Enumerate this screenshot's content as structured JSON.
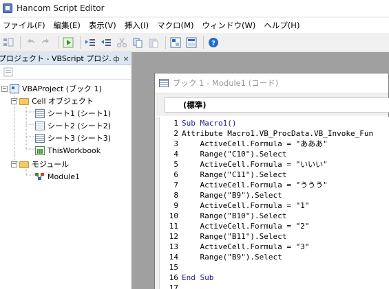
{
  "window": {
    "title": "Hancom Script Editor"
  },
  "menu": [
    "ファイル(F)",
    "編集(E)",
    "表示(V)",
    "挿入(I)",
    "マクロ(M)",
    "ウィンドウ(W)",
    "ヘルプ(H)"
  ],
  "toolbar": {
    "buttons": [
      "view-object-icon",
      "undo-icon",
      "redo-icon",
      "run-icon",
      "indent-icon",
      "outdent-icon",
      "cut-icon",
      "copy-icon",
      "paste-icon",
      "project-explorer-icon",
      "properties-icon",
      "help-icon"
    ]
  },
  "project_panel": {
    "title": "プロジェクト - VBScript プロジ...",
    "pin": "ф",
    "close": "×",
    "tree": {
      "project": "VBAProject (ブック 1)",
      "objects_folder": "Cell オブジェクト",
      "sheets": [
        "シート1 (シート1)",
        "シート2 (シート2)",
        "シート3 (シート3)"
      ],
      "workbook": "ThisWorkbook",
      "modules_folder": "モジュール",
      "modules": [
        "Module1"
      ]
    }
  },
  "code_window": {
    "title": "ブック 1 - Module1 (コード)",
    "procedure_combo": "(標準)",
    "lines": [
      {
        "n": "1",
        "text": "Sub Macro1()"
      },
      {
        "n": "2",
        "text": "Attribute Macro1.VB_ProcData.VB_Invoke_Fun"
      },
      {
        "n": "3",
        "text": "    ActiveCell.Formula = \"あああ\""
      },
      {
        "n": "4",
        "text": "    Range(\"C10\").Select"
      },
      {
        "n": "5",
        "text": "    ActiveCell.Formula = \"いいい\""
      },
      {
        "n": "6",
        "text": "    Range(\"C11\").Select"
      },
      {
        "n": "7",
        "text": "    ActiveCell.Formula = \"ううう\""
      },
      {
        "n": "8",
        "text": "    Range(\"B9\").Select"
      },
      {
        "n": "9",
        "text": "    ActiveCell.Formula = \"1\""
      },
      {
        "n": "10",
        "text": "    Range(\"B10\").Select"
      },
      {
        "n": "11",
        "text": "    ActiveCell.Formula = \"2\""
      },
      {
        "n": "12",
        "text": "    Range(\"B11\").Select"
      },
      {
        "n": "13",
        "text": "    ActiveCell.Formula = \"3\""
      },
      {
        "n": "14",
        "text": "    Range(\"B9\").Select"
      },
      {
        "n": "15",
        "text": ""
      },
      {
        "n": "16",
        "text": "End Sub"
      },
      {
        "n": "17",
        "text": ""
      }
    ]
  }
}
